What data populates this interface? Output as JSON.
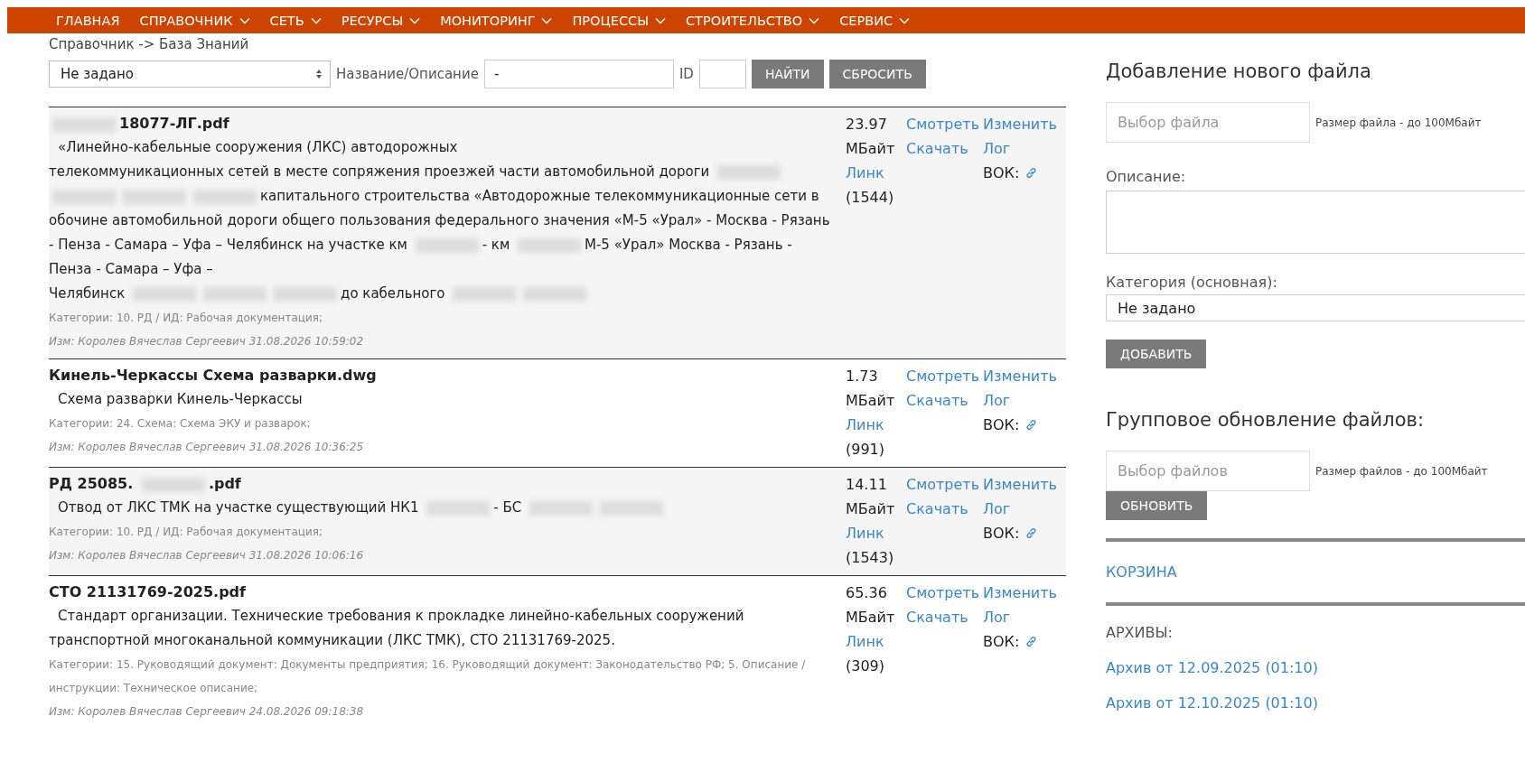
{
  "nav": [
    {
      "label": "ГЛАВНАЯ",
      "dropdown": false
    },
    {
      "label": "СПРАВОЧНИК",
      "dropdown": true
    },
    {
      "label": "СЕТЬ",
      "dropdown": true
    },
    {
      "label": "РЕСУРСЫ",
      "dropdown": true
    },
    {
      "label": "МОНИТОРИНГ",
      "dropdown": true
    },
    {
      "label": "ПРОЦЕССЫ",
      "dropdown": true
    },
    {
      "label": "СТРОИТЕЛЬСТВО",
      "dropdown": true
    },
    {
      "label": "СЕРВИС",
      "dropdown": true
    }
  ],
  "breadcrumb": "Справочник -> База Знаний",
  "filter": {
    "category": "Не задано",
    "name_label": "Название/Описание",
    "name_value": "-",
    "id_label": "ID",
    "buttons": [
      "НАЙТИ",
      "СБРОСИТЬ"
    ]
  },
  "files": [
    {
      "title": [
        {
          "kind": "redacted"
        },
        {
          "kind": "text",
          "text": "18077-ЛГ.pdf"
        }
      ],
      "description": [
        {
          "kind": "text",
          "text": "«Линейно-кабельные сооружения (ЛКС) автодорожных"
        },
        {
          "kind": "break"
        },
        {
          "kind": "text",
          "text": "телекоммуникационных сетей в месте сопряжения проезжей части автомобильной дороги"
        },
        {
          "kind": "redacted"
        },
        {
          "kind": "redacted"
        },
        {
          "kind": "redacted"
        },
        {
          "kind": "redacted"
        },
        {
          "kind": "text",
          "text": "капитального строительства «Автодорожные телекоммуникационные сети в обочине автомобильной дороги общего пользования федерального значения «М-5 «Урал» - Москва - Рязань - Пенза - Самара – Уфа – Челябинск на участке км"
        },
        {
          "kind": "redacted"
        },
        {
          "kind": "text",
          "text": "- км"
        },
        {
          "kind": "redacted"
        },
        {
          "kind": "text",
          "text": "М-5 «Урал» Москва - Рязань - Пенза - Самара – Уфа –"
        },
        {
          "kind": "break"
        },
        {
          "kind": "text",
          "text": "Челябинск"
        },
        {
          "kind": "redacted"
        },
        {
          "kind": "redacted"
        },
        {
          "kind": "redacted"
        },
        {
          "kind": "text",
          "text": "до кабельного"
        },
        {
          "kind": "redacted"
        },
        {
          "kind": "redacted"
        }
      ],
      "categories": "Категории: 10. РД / ИД: Рабочая документация;",
      "modified": "Изм: Королев Вячеслав Сергеевич 31.08.2026 10:59:02",
      "size": "23.97",
      "unit": "МБайт",
      "link": "Линк",
      "count": "(1544)",
      "view": "Смотреть",
      "download": "Скачать",
      "edit": "Изменить",
      "log": "Лог",
      "vok": "ВОК:"
    },
    {
      "title": [
        {
          "kind": "text",
          "text": "Кинель-Черкассы Схема разварки.dwg"
        }
      ],
      "description": [
        {
          "kind": "text",
          "text": "Схема разварки Кинель-Черкассы"
        }
      ],
      "categories": "Категории: 24. Схема: Схема ЭКУ и разварок;",
      "modified": "Изм: Королев Вячеслав Сергеевич 31.08.2026 10:36:25",
      "size": "1.73",
      "unit": "МБайт",
      "link": "Линк",
      "count": "(991)",
      "view": "Смотреть",
      "download": "Скачать",
      "edit": "Изменить",
      "log": "Лог",
      "vok": "ВОК:"
    },
    {
      "title": [
        {
          "kind": "text",
          "text": "РД 25085."
        },
        {
          "kind": "redacted"
        },
        {
          "kind": "text",
          "text": ".pdf"
        }
      ],
      "description": [
        {
          "kind": "text",
          "text": "Отвод от ЛКС ТМК на участке существующий НК1"
        },
        {
          "kind": "redacted"
        },
        {
          "kind": "text",
          "text": "- БС"
        },
        {
          "kind": "redacted"
        },
        {
          "kind": "redacted"
        }
      ],
      "categories": "Категории: 10. РД / ИД: Рабочая документация;",
      "modified": "Изм: Королев Вячеслав Сергеевич 31.08.2026 10:06:16",
      "size": "14.11",
      "unit": "МБайт",
      "link": "Линк",
      "count": "(1543)",
      "view": "Смотреть",
      "download": "Скачать",
      "edit": "Изменить",
      "log": "Лог",
      "vok": "ВОК:"
    },
    {
      "title": [
        {
          "kind": "text",
          "text": "СТО 21131769-2025.pdf"
        }
      ],
      "description": [
        {
          "kind": "text",
          "text": "Стандарт организации. Технические требования к прокладке линейно-кабельных сооружений транспортной многоканальной коммуникации (ЛКС ТМК), СТО 21131769-2025."
        }
      ],
      "categories": "Категории: 15. Руководящий документ: Документы предприятия; 16. Руководящий документ: Законодательство РФ; 5. Описание / инструкции: Техническое описание;",
      "modified": "Изм: Королев Вячеслав Сергеевич 24.08.2026 09:18:38",
      "size": "65.36",
      "unit": "МБайт",
      "link": "Линк",
      "count": "(309)",
      "view": "Смотреть",
      "download": "Скачать",
      "edit": "Изменить",
      "log": "Лог",
      "vok": "ВОК:"
    }
  ],
  "sidebar": {
    "add_title": "Добавление нового файла",
    "file_placeholder": "Выбор файла",
    "file_note": "Размер файла - до 100Мбайт",
    "description_label": "Описание:",
    "category_label": "Категория (основная):",
    "category_value": "Не задано",
    "add_button": "ДОБАВИТЬ",
    "group_title": "Групповое обновление файлов:",
    "files_placeholder": "Выбор файлов",
    "files_note": "Размер файлов - до 100Мбайт",
    "update_button": "ОБНОВИТЬ",
    "trash_link": "КОРЗИНА",
    "archives_label": "АРХИВЫ:",
    "archives": [
      "Архив от 12.09.2025 (01:10)",
      "Архив от 12.10.2025 (01:10)"
    ]
  }
}
